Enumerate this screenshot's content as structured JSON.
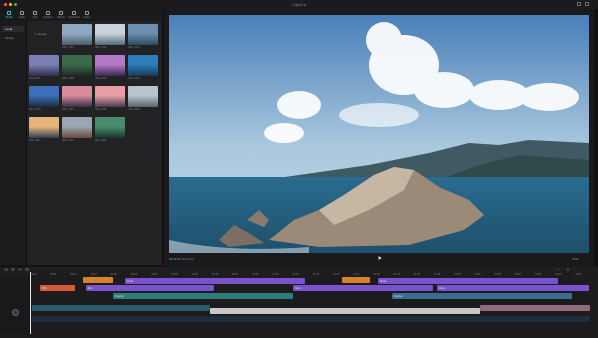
{
  "app": {
    "title": "CapCut"
  },
  "colors": {
    "accent": "#3fc5d2",
    "text_clip": "#d35b3b",
    "audio_clip": "#7a52c9",
    "sticker_clip": "#d6822a",
    "video_clip": "#1f6b6b"
  },
  "toolbar": {
    "items": [
      {
        "label": "Media",
        "icon": "media-icon"
      },
      {
        "label": "Audio",
        "icon": "audio-icon"
      },
      {
        "label": "Text",
        "icon": "text-icon"
      },
      {
        "label": "Stickers",
        "icon": "sticker-icon"
      },
      {
        "label": "Effects",
        "icon": "effects-icon"
      },
      {
        "label": "Transitions",
        "icon": "transition-icon"
      },
      {
        "label": "Filters",
        "icon": "filter-icon"
      }
    ]
  },
  "sidebar": {
    "items": [
      {
        "label": "Local"
      },
      {
        "label": "Library"
      }
    ]
  },
  "media": {
    "import_label": "Import",
    "thumbs": [
      {
        "caption": "IMG_0741",
        "colors": [
          "#8fa9c4",
          "#4c5b64"
        ]
      },
      {
        "caption": "IMG_0742",
        "colors": [
          "#c9d3dc",
          "#4e6a78"
        ]
      },
      {
        "caption": "IMG_0745",
        "colors": [
          "#6c8fb0",
          "#2c4b5d"
        ]
      },
      {
        "caption": "IMG_0761",
        "colors": [
          "#7c7fb4",
          "#2d2e4a"
        ]
      },
      {
        "caption": "IMG_0769",
        "colors": [
          "#3b6a4a",
          "#1c2a22"
        ]
      },
      {
        "caption": "IMG_0770",
        "colors": [
          "#b57ac7",
          "#3a2753"
        ]
      },
      {
        "caption": "IMG_0781",
        "colors": [
          "#2d7db9",
          "#143b5a"
        ]
      },
      {
        "caption": "IMG_0783",
        "colors": [
          "#3c6fb8",
          "#1d2b3d"
        ]
      },
      {
        "caption": "IMG_0790",
        "colors": [
          "#d98ba0",
          "#3a2e45"
        ]
      },
      {
        "caption": "IMG_0792",
        "colors": [
          "#e8a0a6",
          "#4a3a4f"
        ]
      },
      {
        "caption": "IMG_0801",
        "colors": [
          "#b9c3cc",
          "#5a646c"
        ]
      },
      {
        "caption": "IMG_0812",
        "colors": [
          "#e7b67a",
          "#2f3e52"
        ]
      },
      {
        "caption": "IMG_0815",
        "colors": [
          "#9aa6b3",
          "#6b4a3a"
        ]
      },
      {
        "caption": "IMG_0820",
        "colors": [
          "#4a8a6e",
          "#17362b"
        ]
      }
    ]
  },
  "preview": {
    "timecode": "00:00:00",
    "duration": "00:02:14",
    "ratio": "Ratio"
  },
  "timeline": {
    "ticks": [
      "00:00",
      "00:05",
      "00:10",
      "00:15",
      "00:20",
      "00:25",
      "00:30",
      "00:35",
      "00:40",
      "00:45",
      "00:50",
      "00:55",
      "01:00",
      "01:05",
      "01:10",
      "01:15",
      "01:20",
      "01:25",
      "01:30",
      "01:35",
      "01:40",
      "01:45",
      "01:50",
      "01:55",
      "02:00",
      "02:05",
      "02:10",
      "02:15"
    ],
    "tools": [
      "⟲",
      "⟳",
      "✂",
      "⊟"
    ],
    "tracks": {
      "text_label": "Title",
      "audio": [
        {
          "label": "Music"
        },
        {
          "label": "Music"
        },
        {
          "label": "Music"
        }
      ],
      "stickers": [
        {
          "label": ""
        },
        {
          "label": ""
        },
        {
          "label": ""
        }
      ],
      "effects": [
        {
          "label": "Blur"
        },
        {
          "label": "Glow"
        },
        {
          "label": "Fade"
        }
      ],
      "overlay": [
        {
          "label": "Overlay"
        },
        {
          "label": "Overlay"
        }
      ],
      "main": [
        {
          "label": ""
        },
        {
          "label": ""
        },
        {
          "label": ""
        }
      ]
    },
    "cover_label": "Cover"
  }
}
